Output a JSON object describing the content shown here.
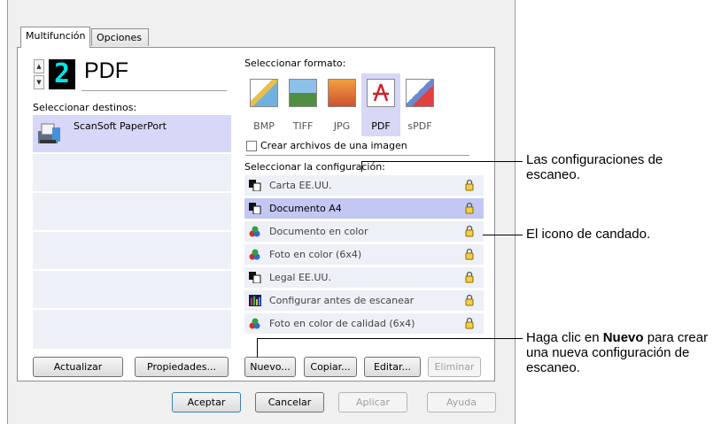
{
  "tabs": [
    "Multifunción",
    "Opciones"
  ],
  "destination": {
    "number": "2",
    "title": "PDF",
    "label": "Seleccionar destinos:",
    "items": [
      "ScanSoft PaperPort"
    ]
  },
  "format": {
    "label": "Seleccionar formato:",
    "items": [
      "BMP",
      "TIFF",
      "JPG",
      "PDF",
      "sPDF"
    ],
    "selected": "PDF",
    "checkbox_label": "Crear archivos de una imagen"
  },
  "config": {
    "label": "Seleccionar la configuración:",
    "items": [
      {
        "label": "Carta EE.UU.",
        "icon": "document-bw-icon"
      },
      {
        "label": "Documento A4",
        "icon": "document-bw-icon"
      },
      {
        "label": "Documento en color",
        "icon": "color-document-icon"
      },
      {
        "label": "Foto en color (6x4)",
        "icon": "color-photo-icon"
      },
      {
        "label": "Legal EE.UU.",
        "icon": "document-bw-icon"
      },
      {
        "label": "Configurar antes de escanear",
        "icon": "configure-icon"
      },
      {
        "label": "Foto en color de calidad (6x4)",
        "icon": "color-photo-icon"
      }
    ],
    "selected_index": 1
  },
  "buttons": {
    "actualizar": "Actualizar",
    "propiedades": "Propiedades...",
    "nuevo": "Nuevo...",
    "copiar": "Copiar...",
    "editar": "Editar...",
    "eliminar": "Eliminar",
    "aceptar": "Aceptar",
    "cancelar": "Cancelar",
    "aplicar": "Aplicar",
    "ayuda": "Ayuda"
  },
  "callouts": {
    "configs": "Las configuraciones de escaneo.",
    "lock": "El icono de candado.",
    "new_prefix": "Haga clic en ",
    "new_bold": "Nuevo",
    "new_suffix": " para crear una nueva configuración de escaneo."
  }
}
